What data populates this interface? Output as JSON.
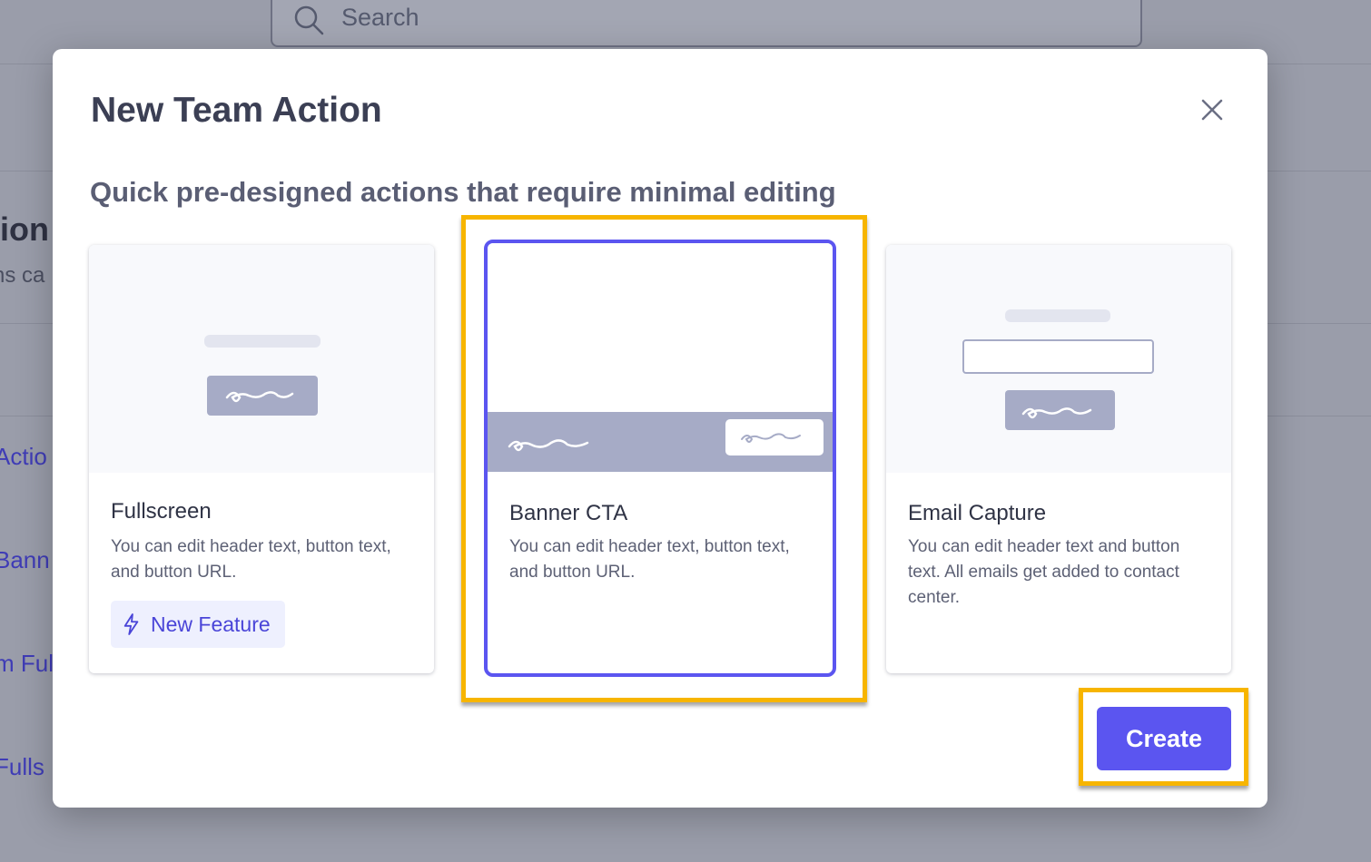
{
  "background": {
    "search_placeholder": "Search",
    "heading_fragment": "tion",
    "subtitle_fragment": "ns ca",
    "list_fragments": [
      "Actio",
      "Bann",
      "m Ful",
      "Fulls"
    ]
  },
  "modal": {
    "title": "New Team Action",
    "subtitle": "Quick pre-designed actions that require minimal editing",
    "close_icon": "close-icon",
    "cards": [
      {
        "title": "Fullscreen",
        "description": "You can edit header text, button text, and button URL.",
        "badge": "New Feature",
        "badge_icon": "lightning-icon",
        "selected": false
      },
      {
        "title": "Banner CTA",
        "description": "You can edit header text, button text, and button URL.",
        "selected": true
      },
      {
        "title": "Email Capture",
        "description": "You can edit header text and button text. All emails get added to contact center.",
        "selected": false
      }
    ],
    "create_label": "Create"
  },
  "colors": {
    "accent": "#5b55f0",
    "highlight": "#f7b500",
    "placeholder": "#a6abc6"
  }
}
